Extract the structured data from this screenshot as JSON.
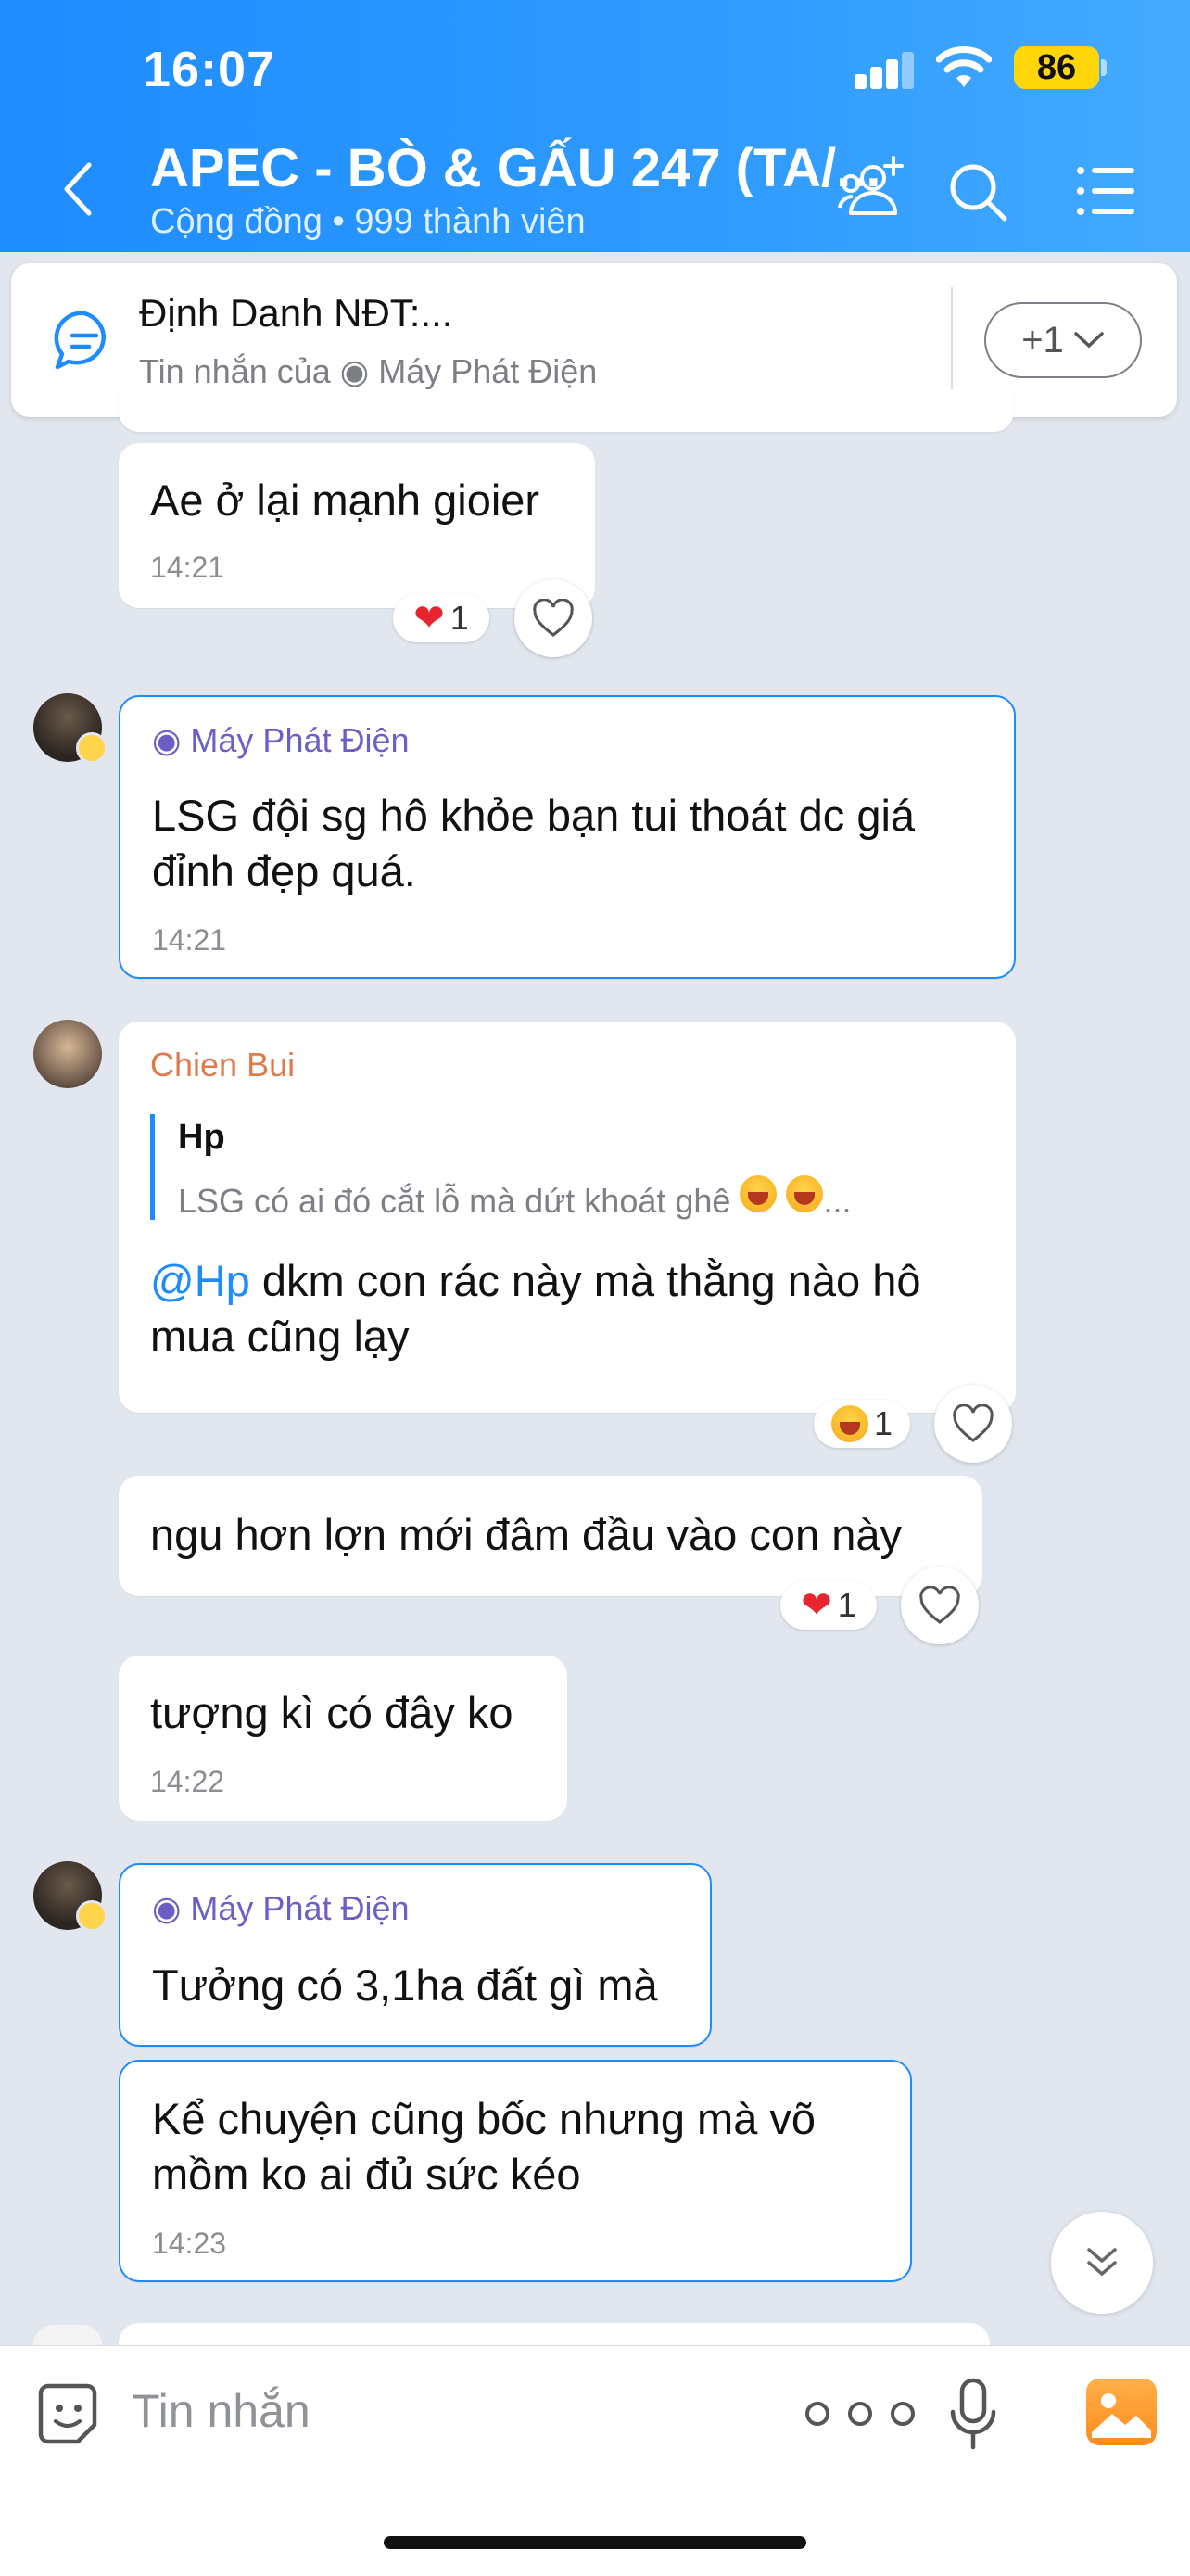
{
  "status_bar": {
    "time": "16:07",
    "battery": "86"
  },
  "header": {
    "title": "APEC - BÒ & GẤU 247 (TA/...",
    "subtitle": "Cộng đồng • 999 thành viên"
  },
  "pinned": {
    "title": "Định Danh NĐT:...",
    "subtitle": "Tin nhắn của ◉ Máy Phát Điện",
    "more_label": "+1"
  },
  "messages": [
    {
      "text": "Ae ở lại mạnh gioier",
      "time": "14:21",
      "reaction_count": "1"
    },
    {
      "sender": "◉ Máy Phát Điện",
      "text_line1": "LSG đội sg hô khỏe bạn tui thoát dc giá",
      "text_line2": "đỉnh đẹp quá.",
      "time": "14:21"
    },
    {
      "sender": "Chien Bui",
      "quote_author": "Hp",
      "quote_text": "LSG có ai đó cắt lỗ mà dứt khoát ghê",
      "quote_ellipsis": "...",
      "mention": "@Hp",
      "text_line1": " dkm con rác này mà thằng nào hô",
      "text_line2": "mua cũng lạy",
      "reaction_count": "1"
    },
    {
      "text": "ngu hơn lợn mới đâm đầu vào con này",
      "reaction_count": "1"
    },
    {
      "text": "tượng kì có đây ko",
      "time": "14:22"
    },
    {
      "sender": "◉ Máy Phát Điện",
      "text": "Tưởng có 3,1ha đất gì mà"
    },
    {
      "text_line1": "Kể chuyện cũng bốc nhưng mà võ",
      "text_line2": "mồm ko ai đủ sức kéo",
      "time": "14:23"
    }
  ],
  "composer": {
    "placeholder": "Tin nhắn"
  },
  "colors": {
    "header_blue": "#1e8cff",
    "sender_purple": "#6a5fc7",
    "sender_orange": "#e07a4b",
    "mention_blue": "#1e8cff",
    "heart_red": "#e8242f"
  },
  "icons": [
    "back-icon",
    "members-icon",
    "search-icon",
    "menu-icon",
    "chat-icon",
    "chevron-down-icon",
    "heart-icon",
    "sticker-icon",
    "more-icon",
    "mic-icon",
    "image-icon",
    "double-chevron-down-icon"
  ]
}
